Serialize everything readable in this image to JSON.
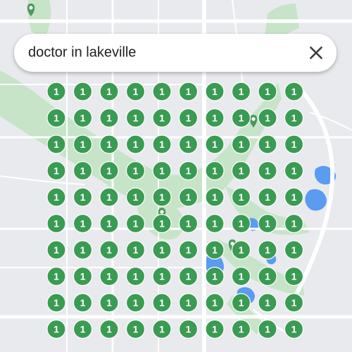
{
  "search": {
    "query": "doctor in lakeville",
    "close_icon": "close-icon"
  },
  "map": {
    "colors": {
      "background": "#e9eaee",
      "park": "#c7e4c9",
      "water": "#5b9bf0",
      "road": "#ffffff",
      "marker": "#3a9b52",
      "marker_text": "#ffffff",
      "poi_marker": "#4a9a5b",
      "selected": "#d93025"
    },
    "cluster_markers": {
      "rows": 10,
      "columns": 10,
      "label": "1"
    },
    "poi_icons": [
      "medical-pin-icon",
      "medical-pin-icon",
      "medical-pin-icon",
      "medical-pin-icon"
    ]
  }
}
